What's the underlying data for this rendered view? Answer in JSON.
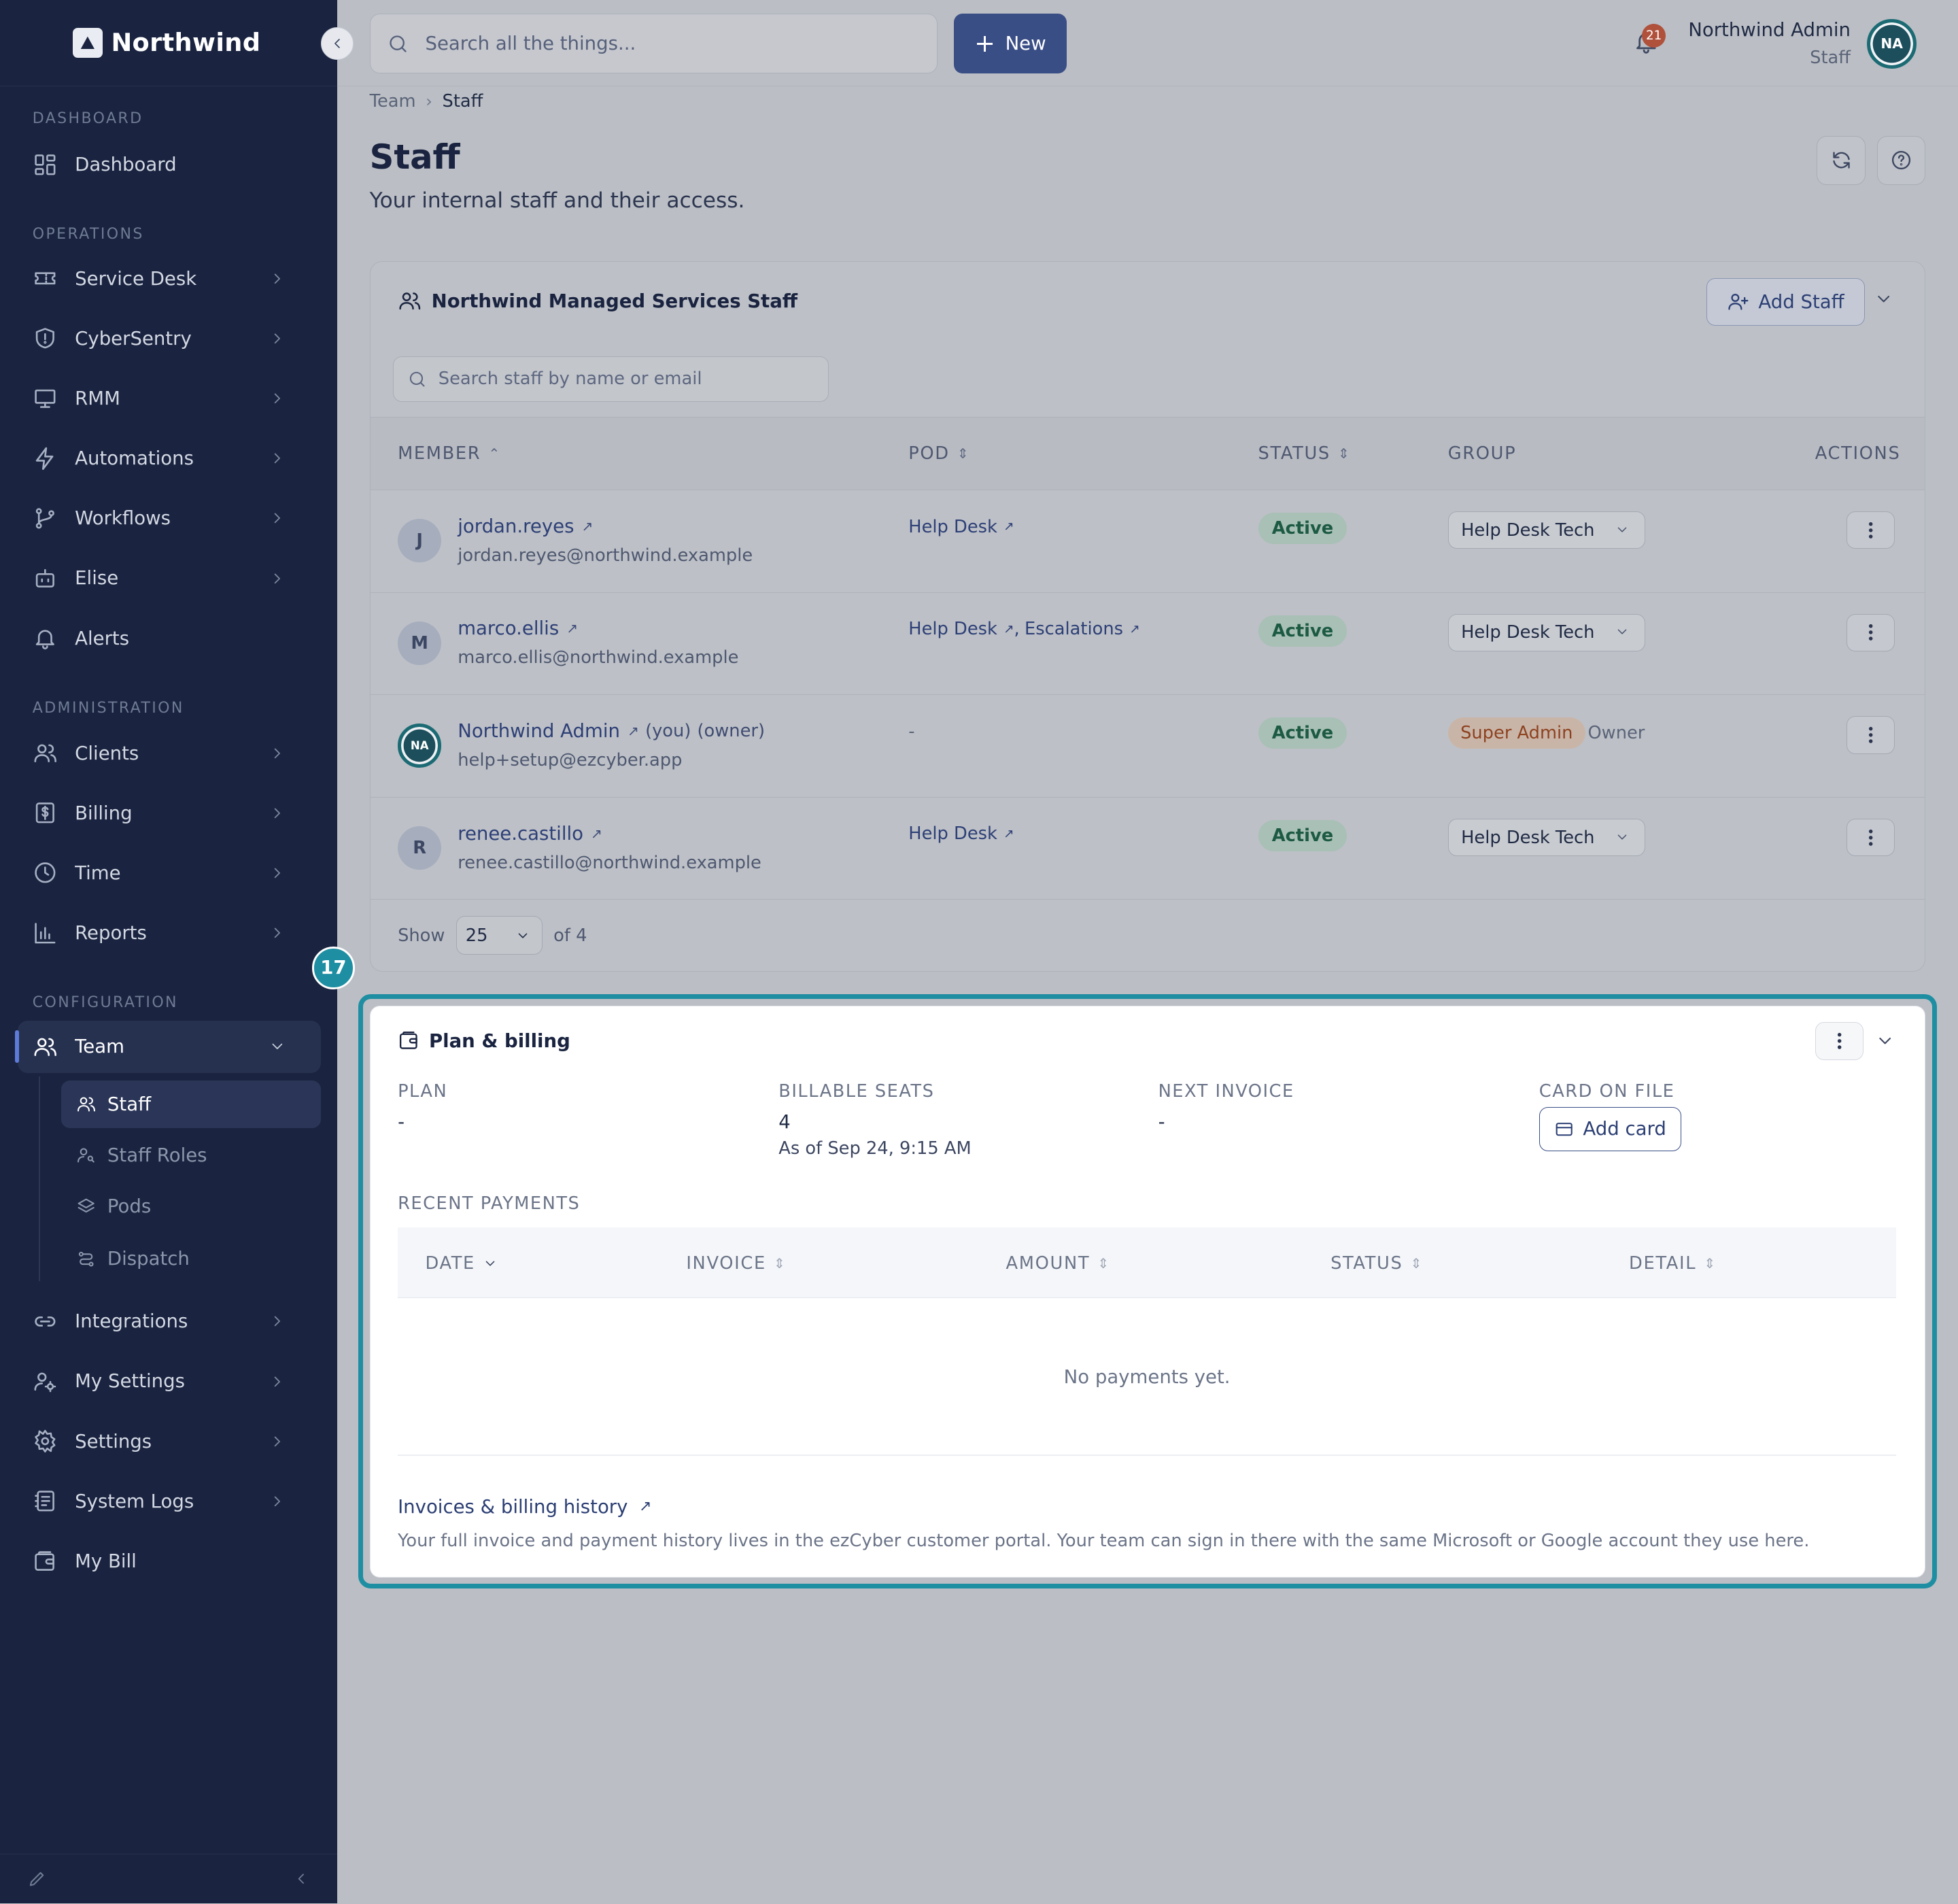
{
  "brand": {
    "name": "Northwind",
    "logo_icon": "triangle-icon"
  },
  "sidebar": {
    "sections": {
      "dashboard": "DASHBOARD",
      "operations": "OPERATIONS",
      "administration": "ADMINISTRATION",
      "configuration": "CONFIGURATION"
    },
    "items": {
      "dashboard": "Dashboard",
      "service_desk": "Service Desk",
      "cybersentry": "CyberSentry",
      "rmm": "RMM",
      "automations": "Automations",
      "workflows": "Workflows",
      "elise": "Elise",
      "alerts": "Alerts",
      "clients": "Clients",
      "billing": "Billing",
      "time": "Time",
      "reports": "Reports",
      "team": "Team",
      "integrations": "Integrations",
      "my_settings": "My Settings",
      "settings": "Settings",
      "system_logs": "System Logs",
      "my_bill": "My Bill"
    },
    "team_sub": {
      "staff": "Staff",
      "staff_roles": "Staff Roles",
      "pods": "Pods",
      "dispatch": "Dispatch"
    },
    "active_item": "Team",
    "active_sub_item": "Staff"
  },
  "topbar": {
    "search_placeholder": "Search all the things...",
    "new_label": "New",
    "notification_count": "21",
    "user_name": "Northwind Admin",
    "user_role": "Staff",
    "avatar_initials": "NA"
  },
  "breadcrumb": {
    "parent": "Team",
    "current": "Staff"
  },
  "page": {
    "title": "Staff",
    "subtitle": "Your internal staff and their access."
  },
  "staff_card": {
    "title": "Northwind Managed Services Staff",
    "add_label": "Add Staff",
    "search_placeholder": "Search staff by name or email",
    "columns": {
      "member": "MEMBER",
      "pod": "POD",
      "status": "STATUS",
      "group": "GROUP",
      "actions": "ACTIONS"
    },
    "rows": [
      {
        "initial": "J",
        "name": "jordan.reyes",
        "email": "jordan.reyes@northwind.example",
        "pod1": "Help Desk",
        "status": "Active",
        "group": "Help Desk Tech"
      },
      {
        "initial": "M",
        "name": "marco.ellis",
        "email": "marco.ellis@northwind.example",
        "pod1": "Help Desk",
        "pod2": "Escalations",
        "status": "Active",
        "group": "Help Desk Tech"
      },
      {
        "initial": "NA",
        "name": "Northwind Admin",
        "you": "(you)",
        "owner_tag": "(owner)",
        "email": "help+setup@ezcyber.app",
        "pod1": "-",
        "status": "Active",
        "group_badge": "Super Admin",
        "group_note": "Owner"
      },
      {
        "initial": "R",
        "name": "renee.castillo",
        "email": "renee.castillo@northwind.example",
        "pod1": "Help Desk",
        "status": "Active",
        "group": "Help Desk Tech"
      }
    ],
    "pager": {
      "show_label": "Show",
      "page_size": "25",
      "total_label": "of 4"
    }
  },
  "highlight_badge": "17",
  "billing": {
    "title": "Plan & billing",
    "plan_label": "PLAN",
    "plan_value": "-",
    "seats_label": "BILLABLE SEATS",
    "seats_value": "4",
    "seats_asof": "As of Sep 24, 9:15 AM",
    "invoice_label": "NEXT INVOICE",
    "invoice_value": "-",
    "card_label": "CARD ON FILE",
    "add_card_label": "Add card",
    "recent_label": "RECENT PAYMENTS",
    "columns": {
      "date": "DATE",
      "invoice": "INVOICE",
      "amount": "AMOUNT",
      "status": "STATUS",
      "detail": "DETAIL"
    },
    "empty_text": "No payments yet.",
    "history_link": "Invoices & billing history",
    "history_note": "Your full invoice and payment history lives in the ezCyber customer portal. Your team can sign in there with the same Microsoft or Google account they use here."
  },
  "colors": {
    "sidebar_bg": "#1a2440",
    "primary": "#3a4e86",
    "highlight": "#1e8ea2",
    "active_green": "#1d5a43",
    "super_admin": "#8d4220",
    "notification": "#b0513c"
  }
}
